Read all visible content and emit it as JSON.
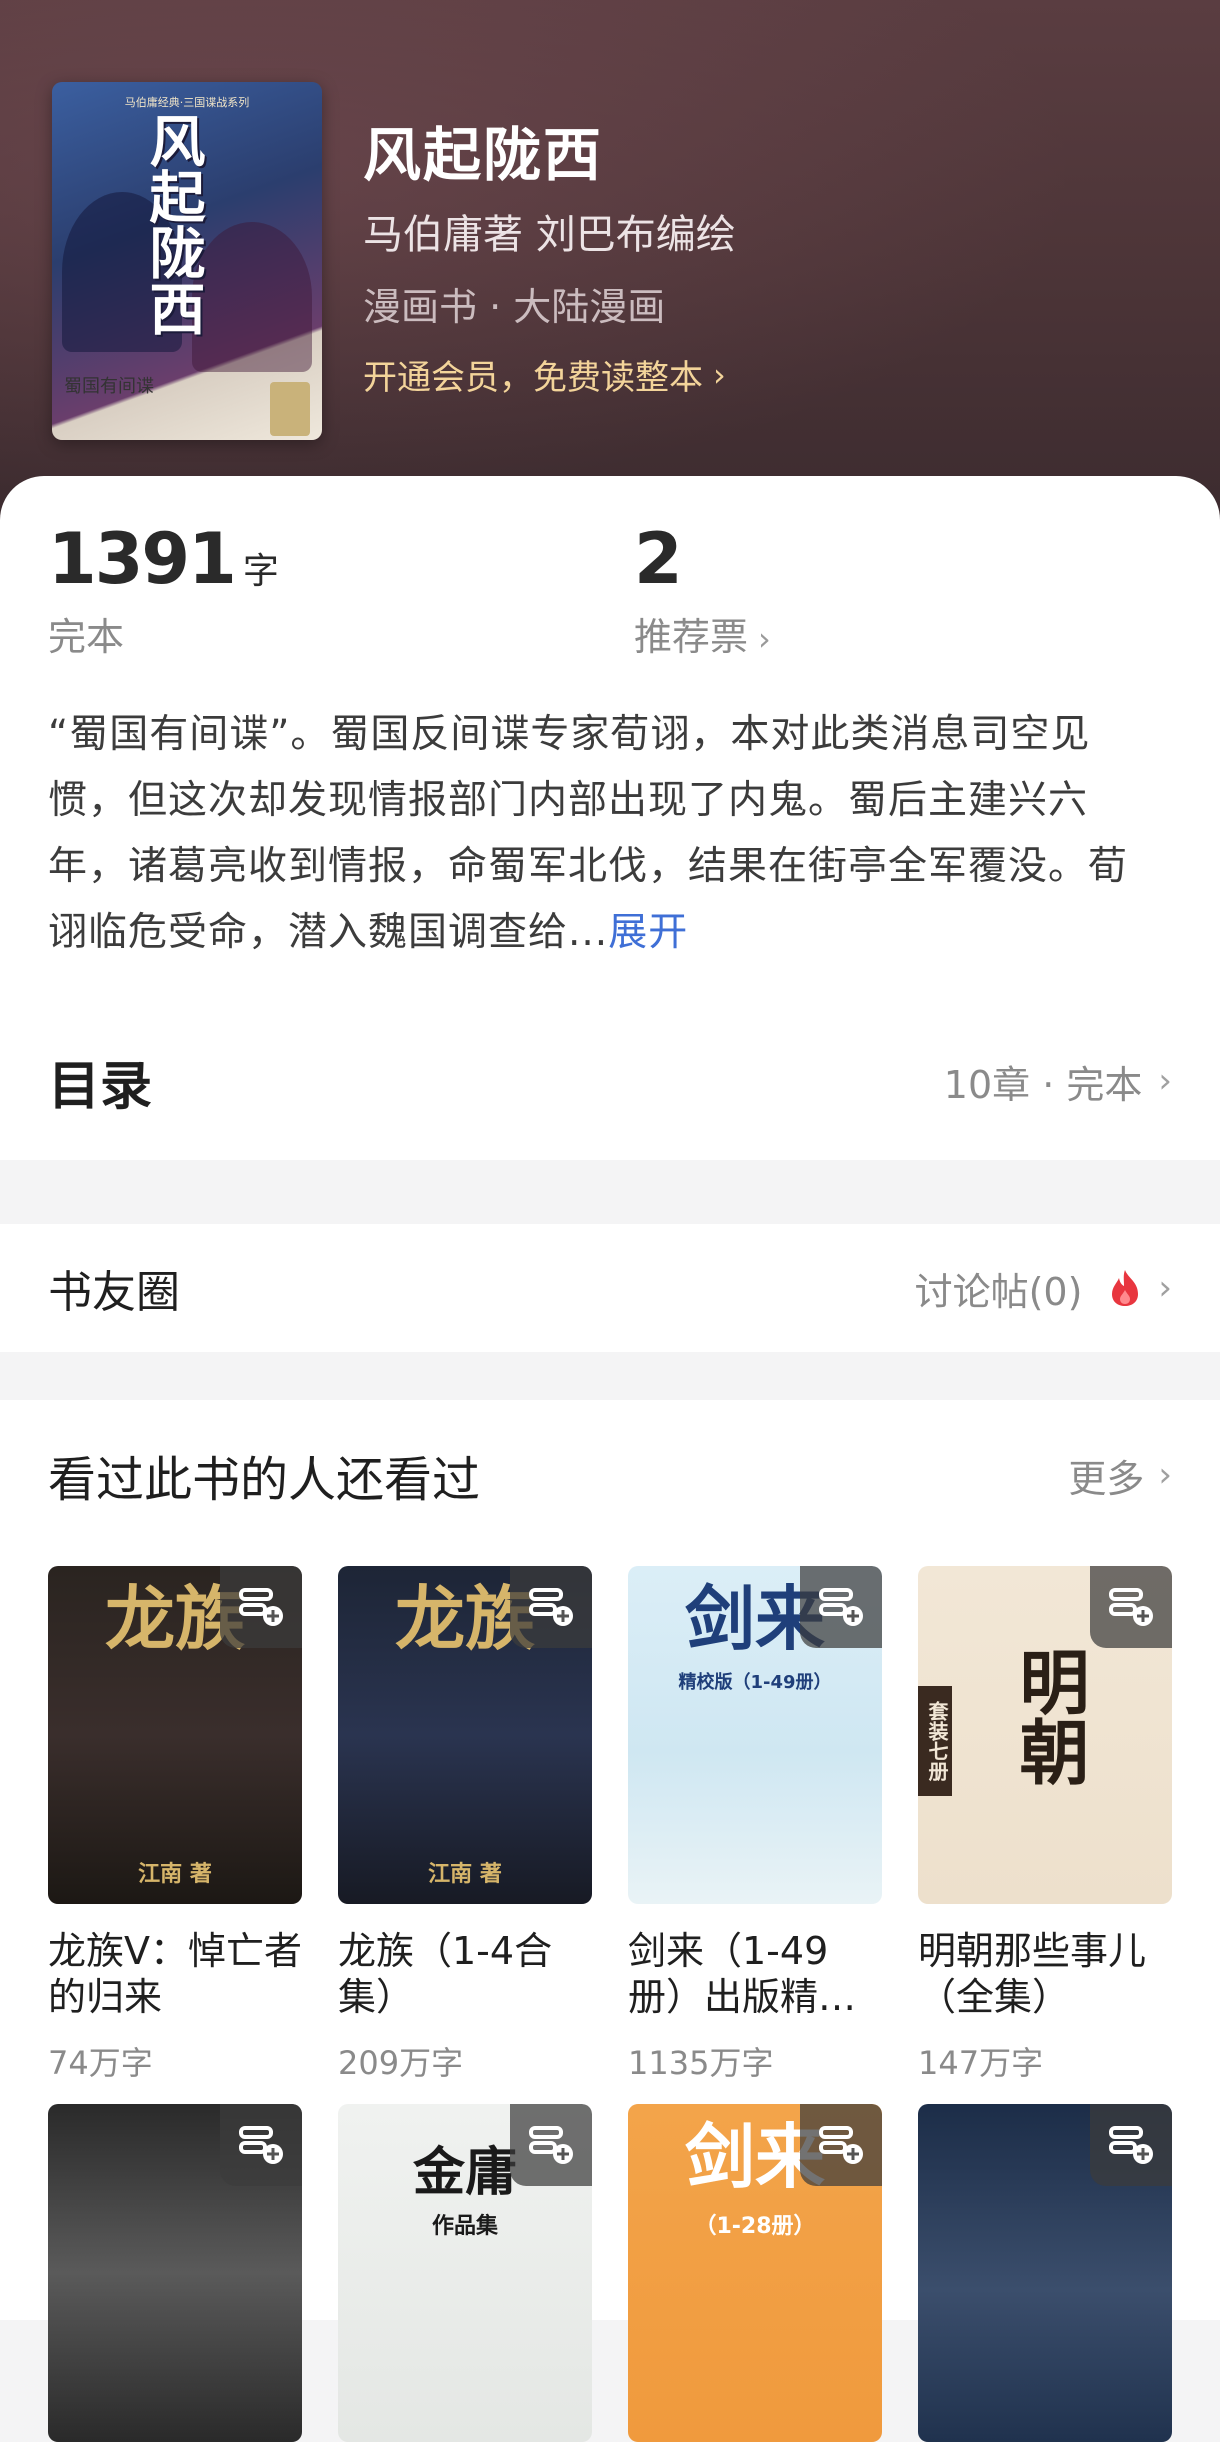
{
  "book": {
    "title": "风起陇西",
    "author": "马伯庸著 刘巴布编绘",
    "genre": "漫画书 · 大陆漫画",
    "vip_text": "开通会员，免费读整本",
    "cover": {
      "series_text": "马伯庸经典·三国谍战系列",
      "title_text": "风起陇西",
      "bottom_text": "蜀国有间谍"
    }
  },
  "stats": {
    "word_count": "1391",
    "word_unit": "字",
    "status": "完本",
    "votes": "2",
    "votes_label": "推荐票"
  },
  "description": {
    "text": "“蜀国有间谍”。蜀国反间谍专家荀诩，本对此类消息司空见惯，但这次却发现情报部门内部出现了内鬼。蜀后主建兴六年，诸葛亮收到情报，命蜀军北伐，结果在街亭全军覆没。荀诩临危受命，潜入魏国调查给...",
    "expand_label": "展开"
  },
  "toc": {
    "title": "目录",
    "meta": "10章 · 完本"
  },
  "circle": {
    "title": "书友圈",
    "meta": "讨论帖(0)"
  },
  "recommend": {
    "title": "看过此书的人还看过",
    "more": "更多",
    "items": [
      {
        "name": "龙族Ⅴ：悼亡者的归来",
        "count": "74万字",
        "cover_text": "龙族",
        "cover_sub": "江南 著"
      },
      {
        "name": "龙族（1-4合集）",
        "count": "209万字",
        "cover_text": "龙族",
        "cover_sub": "江南 著"
      },
      {
        "name": "剑来（1-49册）出版精…",
        "count": "1135万字",
        "cover_text": "剑来",
        "cover_sub": "精校版（1-49册）"
      },
      {
        "name": "明朝那些事儿（全集）",
        "count": "147万字",
        "cover_text": "明朝",
        "cover_sub": "套装七册"
      },
      {
        "name": "",
        "count": "",
        "cover_text": "",
        "cover_sub": ""
      },
      {
        "name": "",
        "count": "",
        "cover_text": "金庸",
        "cover_sub": "作品集"
      },
      {
        "name": "",
        "count": "",
        "cover_text": "剑来",
        "cover_sub": "（1-28册）"
      },
      {
        "name": "",
        "count": "",
        "cover_text": "",
        "cover_sub": ""
      }
    ]
  },
  "colors": {
    "accent_link": "#3f6fd6",
    "vip_gold": "#f3d49a",
    "fire_red": "#e8363f"
  }
}
